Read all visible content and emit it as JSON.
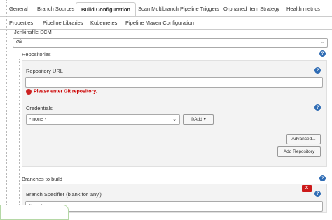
{
  "tabs_row1": [
    {
      "label": "General"
    },
    {
      "label": "Branch Sources"
    },
    {
      "label": "Build Configuration"
    },
    {
      "label": "Scan Multibranch Pipeline Triggers"
    },
    {
      "label": "Orphaned Item Strategy"
    },
    {
      "label": "Health metrics"
    }
  ],
  "tabs_row2": [
    {
      "label": "Properties"
    },
    {
      "label": "Pipeline Libraries"
    },
    {
      "label": "Kubernetes"
    },
    {
      "label": "Pipeline Maven Configuration"
    }
  ],
  "active_tab": "Build Configuration",
  "scm": {
    "section_label": "Jenkinsfile SCM",
    "selected": "Git"
  },
  "repositories": {
    "title": "Repositories",
    "url_label": "Repository URL",
    "url_value": "",
    "error": "Please enter Git repository.",
    "credentials_label": "Credentials",
    "credentials_selected": "- none -",
    "add_label": "Add",
    "advanced_label": "Advanced...",
    "add_repository_label": "Add Repository"
  },
  "branches": {
    "title": "Branches to build",
    "specifier_label": "Branch Specifier (blank for 'any')",
    "specifier_value": "*/master",
    "delete_label": "X"
  },
  "help_icon_char": "?",
  "colors": {
    "error": "#cc0000",
    "help": "#2f6cb4",
    "delete": "#cc1a1a"
  }
}
